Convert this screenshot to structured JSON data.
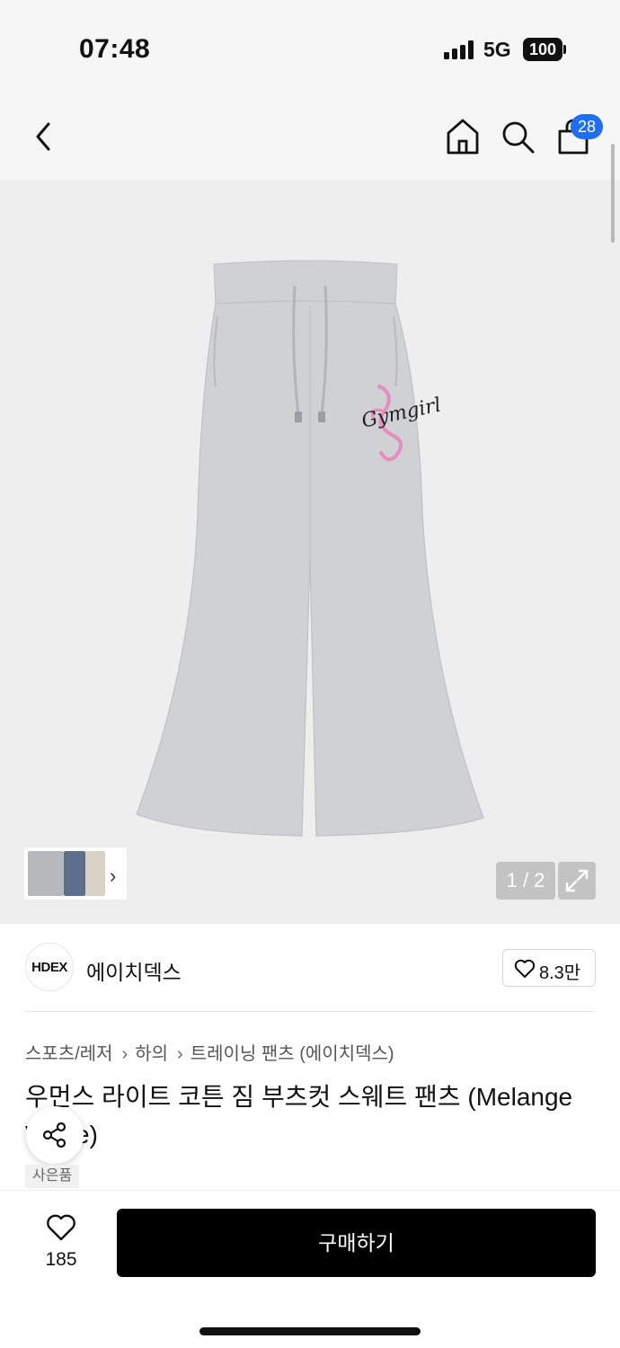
{
  "status_bar": {
    "time": "07:48",
    "network": "5G",
    "battery": "100"
  },
  "nav": {
    "cart_count": "28"
  },
  "gallery": {
    "counter": "1 / 2",
    "image_text": "Gymgirl"
  },
  "brand": {
    "logo_text": "HDEX",
    "name": "에이치덱스",
    "like_count": "8.3만"
  },
  "breadcrumb": [
    "스포츠/레저",
    "하의",
    "트레이닝 팬츠 (에이치덱스)"
  ],
  "product": {
    "title": "우먼스 라이트 코튼 짐 부츠컷 스웨트 팬츠 (Melange White)",
    "gift_label": "사은품"
  },
  "bottom": {
    "wish_count": "185",
    "buy_label": "구매하기"
  },
  "colors": {
    "accent": "#1f6ef5",
    "buy_button": "#000000",
    "gallery_bg": "#eeeeee",
    "pants": "#cfd1d3",
    "logo_pink": "#e98bbf"
  }
}
